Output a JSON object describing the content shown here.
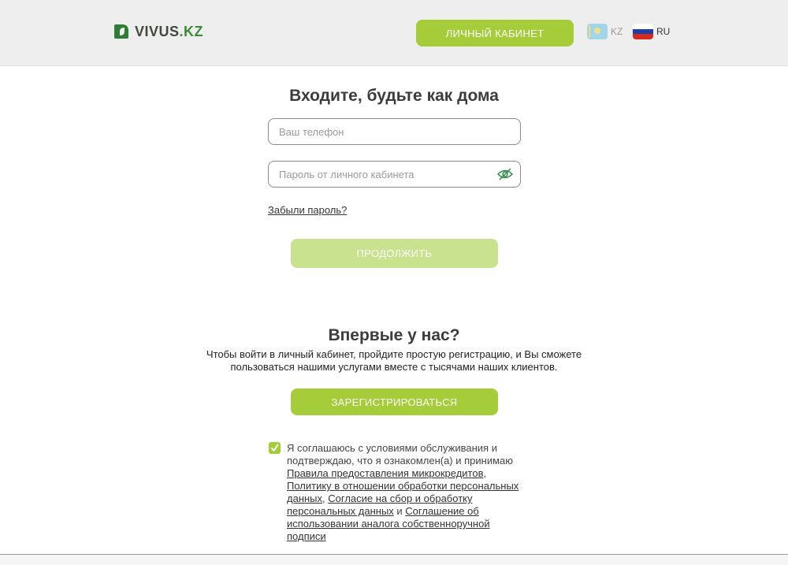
{
  "header": {
    "logo_text": "VIVUS",
    "logo_suffix": ".KZ",
    "cabinet_button": "ЛИЧНЫЙ КАБИНЕТ",
    "languages": [
      {
        "code": "KZ",
        "flag": "kazakhstan-flag-icon",
        "active": false
      },
      {
        "code": "RU",
        "flag": "russia-flag-icon",
        "active": true
      }
    ]
  },
  "login": {
    "title": "Входите, будьте как дома",
    "phone_placeholder": "Ваш телефон",
    "phone_value": "",
    "password_placeholder": "Пароль от личного кабинета",
    "password_value": "",
    "password_toggle_icon": "eye-off-icon",
    "forgot_link": "Забыли пароль?",
    "continue_button": "ПРОДОЛЖИТЬ"
  },
  "register": {
    "title": "Впервые у нас?",
    "description": "Чтобы войти в личный кабинет, пройдите простую регистрацию, и Вы сможете пользоваться нашими услугами вместе с тысячами наших клиентов.",
    "register_button": "ЗАРЕГИСТРИРОВАТЬСЯ"
  },
  "consent": {
    "checked": true,
    "text_before": "Я соглашаюсь с условиями обслуживания и подтверждаю, что я ознакомлен(а) и принимаю ",
    "link1": "Правила предоставления микрокредитов",
    "sep1": ", ",
    "link2": "Политику в отношении обработки персональных данных",
    "sep2": ", ",
    "link3": "Согласие на сбор и обработку персональных данных",
    "sep3": " и ",
    "link4": "Соглашение об использовании аналога собственноручной подписи"
  },
  "colors": {
    "accent": "#a4cd39",
    "accent_disabled": "#c9e28d",
    "header_bg": "#eeeeee",
    "logo_green": "#3f8a3a"
  }
}
